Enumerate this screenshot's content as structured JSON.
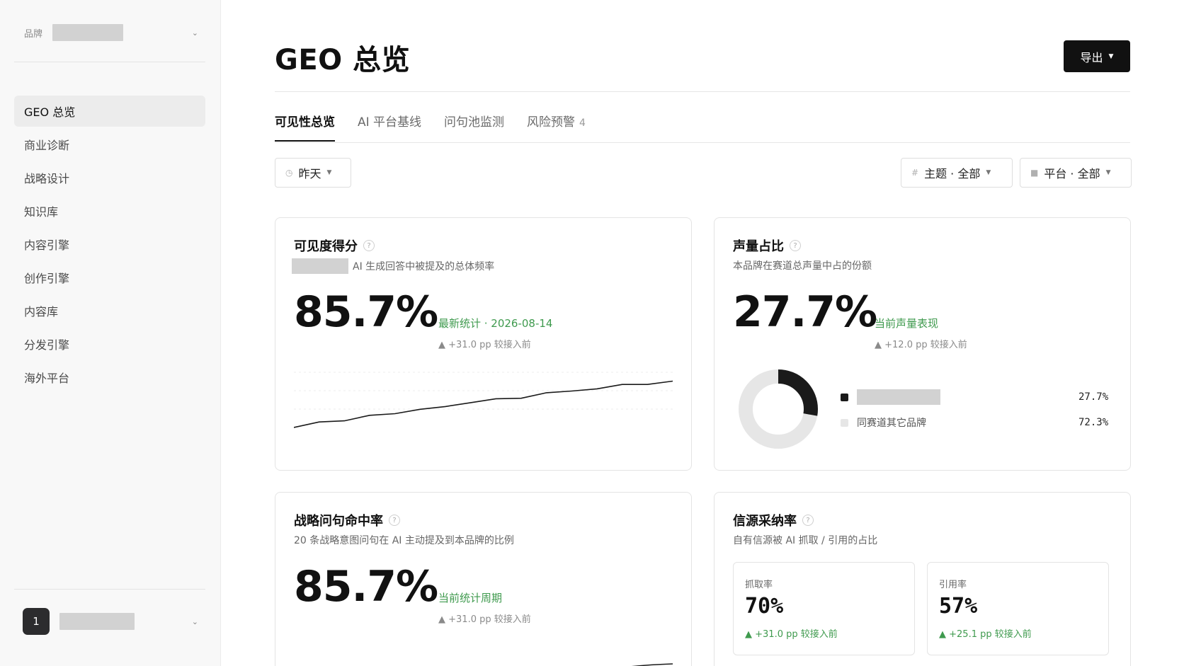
{
  "sidebar": {
    "brand_label": "品牌",
    "nav": [
      "GEO 总览",
      "商业诊断",
      "战略设计",
      "知识库",
      "内容引擎",
      "创作引擎",
      "内容库",
      "分发引擎",
      "海外平台"
    ],
    "active_index": 0,
    "user_avatar": "1"
  },
  "header": {
    "title": "GEO 总览",
    "export_label": "导出"
  },
  "tabs": [
    {
      "label": "可见性总览",
      "active": true
    },
    {
      "label": "AI 平台基线"
    },
    {
      "label": "问句池监测"
    },
    {
      "label": "风险预警",
      "badge": "4"
    }
  ],
  "filters": {
    "date": "昨天",
    "topic": "主题 · 全部",
    "platform": "平台 · 全部"
  },
  "cards": {
    "visibility": {
      "title": "可见度得分",
      "subtitle": "AI 生成回答中被提及的总体频率",
      "value": "85.7%",
      "status": "最新统计 · 2026-08-14",
      "delta": "▲ +31.0 pp 较接入前",
      "trend": [
        0.0,
        0.1,
        0.12,
        0.22,
        0.25,
        0.33,
        0.38,
        0.45,
        0.52,
        0.53,
        0.63,
        0.66,
        0.7,
        0.78,
        0.78,
        0.84
      ]
    },
    "share": {
      "title": "声量占比",
      "subtitle": "本品牌在赛道总声量中占的份额",
      "value": "27.7%",
      "status": "当前声量表现",
      "delta": "▲ +12.0 pp 较接入前",
      "legend": [
        {
          "name": "",
          "value": "27.7%",
          "pct": 27.7,
          "color": "#1a1a1a",
          "redacted": true
        },
        {
          "name": "同赛道其它品牌",
          "value": "72.3%",
          "pct": 72.3,
          "color": "#e6e6e6"
        }
      ]
    },
    "hit_rate": {
      "title": "战略问句命中率",
      "subtitle": "20 条战略意图问句在 AI 主动提及到本品牌的比例",
      "value": "85.7%",
      "status": "当前统计周期",
      "delta": "▲ +31.0 pp 较接入前"
    },
    "source": {
      "title": "信源采纳率",
      "subtitle": "自有信源被 AI 抓取 / 引用的占比",
      "crawl": {
        "label": "抓取率",
        "value": "70%",
        "delta": "▲ +31.0 pp 较接入前"
      },
      "cite": {
        "label": "引用率",
        "value": "57%",
        "delta": "▲ +25.1 pp 较接入前"
      }
    }
  }
}
